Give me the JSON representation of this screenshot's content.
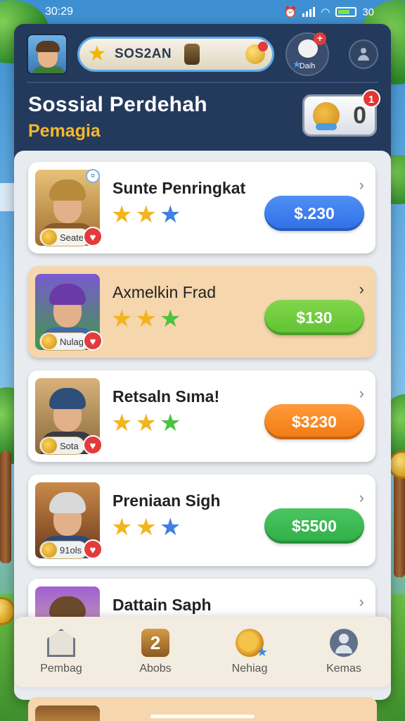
{
  "status_bar": {
    "time": "30:29",
    "battery": "30"
  },
  "header": {
    "search_text": "SOS2AN",
    "pet_label": "Daih",
    "title": "Sossial Perdehah",
    "subtitle": "Pemagia",
    "inbox_count": "0",
    "inbox_badge": "1"
  },
  "cards": [
    {
      "name": "Sunte Penringkat",
      "tag": "Seate",
      "price": "$.230",
      "price_color": "#2f6fe6",
      "stars": [
        "gold",
        "gold",
        "blue"
      ]
    },
    {
      "name": "Axmelkin Frad",
      "tag": "Nulag",
      "price": "$130",
      "price_color": "#5ec232",
      "stars": [
        "gold",
        "gold",
        "green"
      ]
    },
    {
      "name": "Retsaln Sıma!",
      "tag": "Sota",
      "price": "$3230",
      "price_color": "#f27a12",
      "stars": [
        "gold",
        "gold",
        "green"
      ]
    },
    {
      "name": "Preniaan Sigh",
      "tag": "91ols",
      "price": "$5500",
      "price_color": "#2fae48",
      "stars": [
        "gold",
        "gold",
        "blue"
      ]
    },
    {
      "name": "Dattain Saph",
      "tag": "",
      "price": "",
      "price_color": "#5ec232",
      "stars": []
    }
  ],
  "nav": [
    {
      "label": "Pembag",
      "icon": "home-icon"
    },
    {
      "label": "Abobs",
      "icon": "rank-badge-icon"
    },
    {
      "label": "Nehiag",
      "icon": "gear-star-icon"
    },
    {
      "label": "Kemas",
      "icon": "user-icon"
    }
  ]
}
